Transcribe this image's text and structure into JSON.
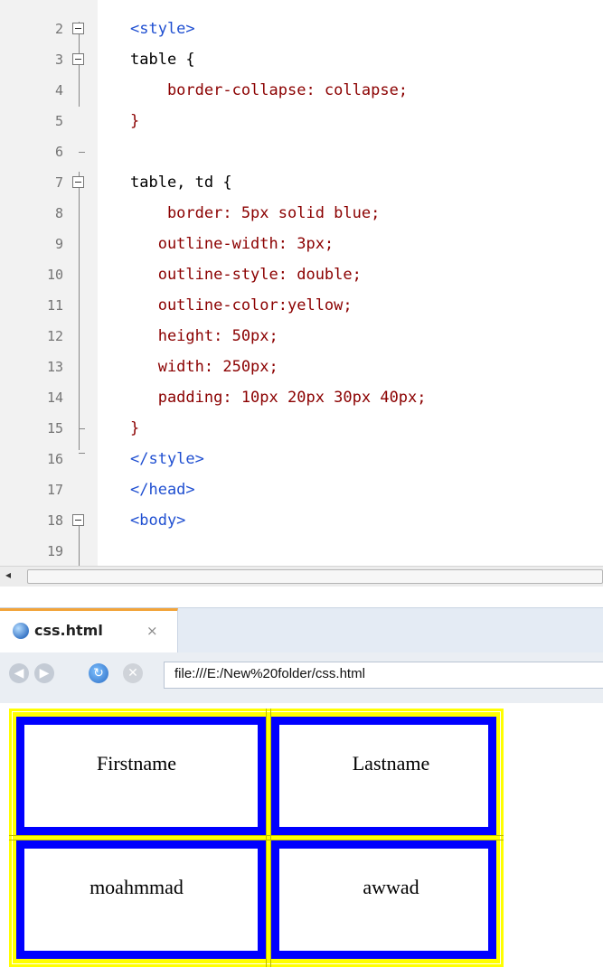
{
  "editor": {
    "lines": [
      {
        "num": "2",
        "code": "<style>"
      },
      {
        "num": "3",
        "code": "table {"
      },
      {
        "num": "4",
        "code": "    border-collapse: collapse;"
      },
      {
        "num": "5",
        "code": "}"
      },
      {
        "num": "6",
        "code": ""
      },
      {
        "num": "7",
        "code": "table, td {"
      },
      {
        "num": "8",
        "code": "    border: 5px solid blue;"
      },
      {
        "num": "9",
        "code": "   outline-width: 3px;"
      },
      {
        "num": "10",
        "code": "   outline-style: double;"
      },
      {
        "num": "11",
        "code": "   outline-color:yellow;"
      },
      {
        "num": "12",
        "code": "   height: 50px;"
      },
      {
        "num": "13",
        "code": "   width: 250px;"
      },
      {
        "num": "14",
        "code": "   padding: 10px 20px 30px 40px;"
      },
      {
        "num": "15",
        "code": "}"
      },
      {
        "num": "16",
        "code": "</style>"
      },
      {
        "num": "17",
        "code": "</head>"
      },
      {
        "num": "18",
        "code": "<body>"
      },
      {
        "num": "19",
        "code": ""
      }
    ]
  },
  "browser": {
    "tab": {
      "title": "css.html",
      "close_glyph": "×"
    },
    "nav": {
      "back_icon": "back-arrow-icon",
      "forward_icon": "forward-arrow-icon",
      "refresh_icon": "refresh-icon",
      "stop_icon": "stop-icon"
    },
    "url": "file:///E:/New%20folder/css.html",
    "table": {
      "rows": [
        [
          "Firstname",
          "Lastname"
        ],
        [
          "moahmmad",
          "awwad"
        ]
      ]
    }
  },
  "colors": {
    "outline": "#ffff00",
    "border": "#0000ff",
    "tab_accent": "#f2a339"
  }
}
